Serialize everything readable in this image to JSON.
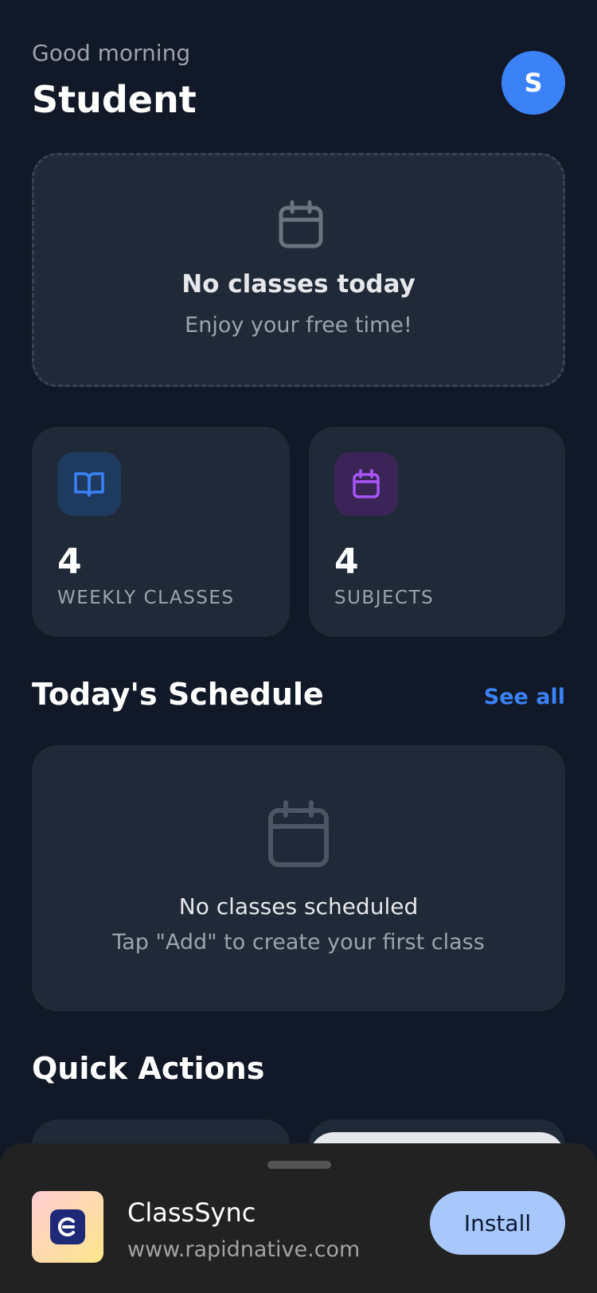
{
  "header": {
    "greeting": "Good morning",
    "user_name": "Student",
    "avatar_initial": "S"
  },
  "hero": {
    "icon": "calendar-icon",
    "title": "No classes today",
    "subtitle": "Enjoy your free time!"
  },
  "stats": [
    {
      "icon": "book-open-icon",
      "value": "4",
      "label": "WEEKLY CLASSES",
      "accent": "#3b82f6"
    },
    {
      "icon": "calendar-icon",
      "value": "4",
      "label": "SUBJECTS",
      "accent": "#a855f7"
    }
  ],
  "schedule": {
    "title": "Today's Schedule",
    "see_all": "See all",
    "empty_title": "No classes scheduled",
    "empty_subtitle": "Tap \"Add\" to create your first class"
  },
  "quick_actions": {
    "title": "Quick Actions"
  },
  "install_banner": {
    "app_name": "ClassSync",
    "url": "www.rapidnative.com",
    "button_label": "Install"
  },
  "colors": {
    "background": "#111827",
    "card": "#1f2937",
    "primary": "#3b82f6",
    "purple": "#a855f7"
  }
}
